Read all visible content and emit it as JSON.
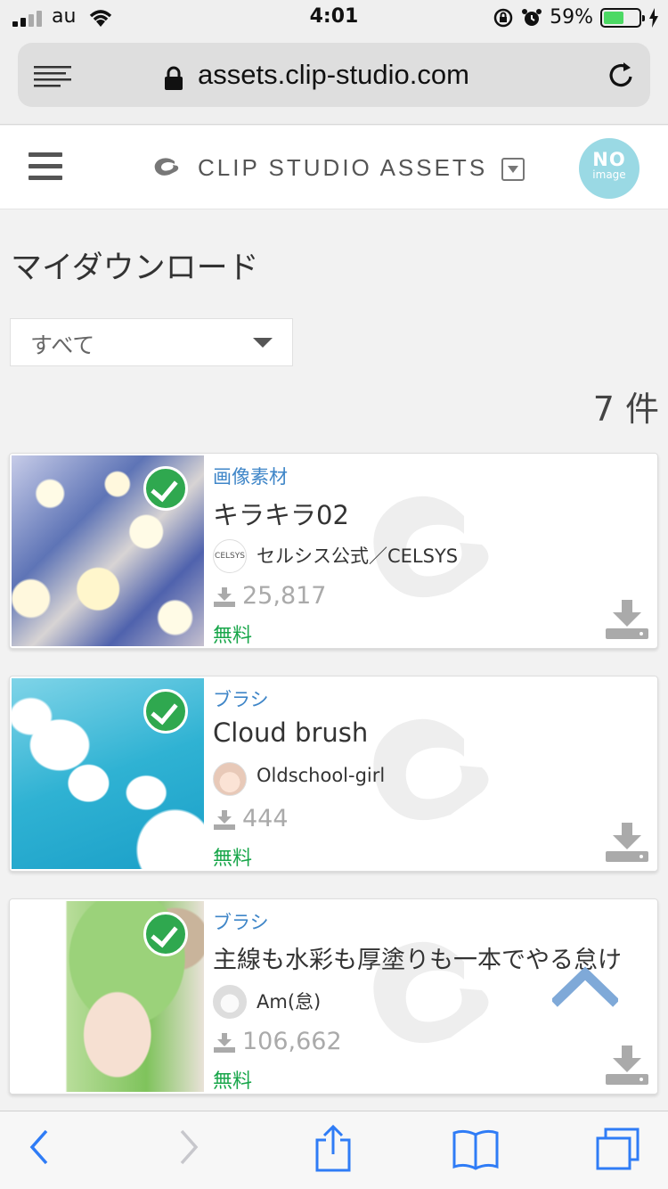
{
  "status_bar": {
    "carrier": "au",
    "time": "4:01",
    "battery": "59%",
    "battery_level": 0.59
  },
  "browser": {
    "url": "assets.clip-studio.com"
  },
  "site": {
    "brand": "CLIP STUDIO ASSETS",
    "avatar_line1": "NO",
    "avatar_line2": "image"
  },
  "page": {
    "title": "マイダウンロード",
    "filter_value": "すべて",
    "count": "7 件"
  },
  "items": [
    {
      "category": "画像素材",
      "name": "キラキラ02",
      "author": "セルシス公式／CELSYS",
      "author_icon_text": "CELSYS",
      "downloads": "25,817",
      "price": "無料"
    },
    {
      "category": "ブラシ",
      "name": "Cloud brush",
      "author": "Oldschool-girl",
      "downloads": "444",
      "price": "無料"
    },
    {
      "category": "ブラシ",
      "name": "主線も水彩も厚塗りも一本でやる怠け",
      "author": "Am(怠)",
      "downloads": "106,662",
      "price": "無料"
    }
  ],
  "colors": {
    "accent_blue": "#3f86c8",
    "free_green": "#18a64a",
    "check_green": "#2fa84f",
    "ios_blue": "#2f7cf6"
  },
  "icons": [
    "reader-icon",
    "lock-icon",
    "reload-icon",
    "hamburger-icon",
    "logo-icon",
    "dropdown-icon",
    "check-icon",
    "download-icon",
    "back-icon",
    "forward-icon",
    "share-icon",
    "bookmarks-icon",
    "tabs-icon",
    "scroll-top-icon"
  ]
}
